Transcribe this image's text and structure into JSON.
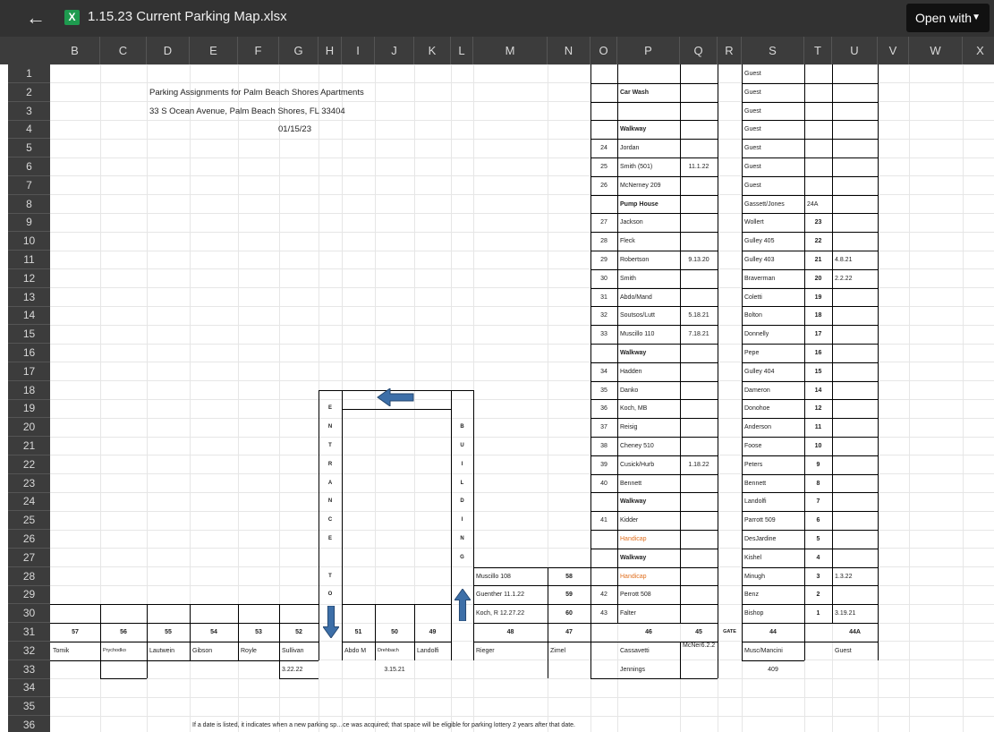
{
  "topbar": {
    "back_glyph": "←",
    "file_icon_letter": "X",
    "file_name": "1.15.23 Current Parking Map.xlsx",
    "open_with_label": "Open with",
    "open_with_caret": "▼"
  },
  "columns": [
    "B",
    "C",
    "D",
    "E",
    "F",
    "G",
    "H",
    "I",
    "J",
    "K",
    "L",
    "M",
    "N",
    "O",
    "P",
    "Q",
    "R",
    "S",
    "T",
    "U",
    "V",
    "W",
    "X"
  ],
  "rows": [
    "1",
    "2",
    "3",
    "4",
    "5",
    "6",
    "7",
    "8",
    "9",
    "10",
    "11",
    "12",
    "13",
    "14",
    "15",
    "16",
    "17",
    "18",
    "19",
    "20",
    "21",
    "22",
    "23",
    "24",
    "25",
    "26",
    "27",
    "28",
    "29",
    "30",
    "31",
    "32",
    "33",
    "34",
    "35",
    "36"
  ],
  "header": {
    "title": "Parking Assignments for Palm Beach Shores Apartments",
    "address": "33 S Ocean Avenue, Palm Beach Shores, FL  33404",
    "date": "01/15/23"
  },
  "colP": [
    {
      "row": 2,
      "num": "",
      "name": "Car Wash",
      "date": "",
      "bold": true
    },
    {
      "row": 4,
      "num": "",
      "name": "Walkway",
      "date": "",
      "bold": true
    },
    {
      "row": 5,
      "num": "24",
      "name": "Jordan",
      "date": ""
    },
    {
      "row": 6,
      "num": "25",
      "name": "Smith (501)",
      "date": "11.1.22"
    },
    {
      "row": 7,
      "num": "26",
      "name": "McNerney 209",
      "date": ""
    },
    {
      "row": 8,
      "num": "",
      "name": "Pump House",
      "date": "",
      "bold": true
    },
    {
      "row": 9,
      "num": "27",
      "name": "Jackson",
      "date": ""
    },
    {
      "row": 10,
      "num": "28",
      "name": "Fleck",
      "date": ""
    },
    {
      "row": 11,
      "num": "29",
      "name": "Robertson",
      "date": "9.13.20"
    },
    {
      "row": 12,
      "num": "30",
      "name": "Smith",
      "date": ""
    },
    {
      "row": 13,
      "num": "31",
      "name": "Abdo/Mand",
      "date": ""
    },
    {
      "row": 14,
      "num": "32",
      "name": "Soutsos/Lutt",
      "date": "5.18.21"
    },
    {
      "row": 15,
      "num": "33",
      "name": "Muscillo 110",
      "date": "7.18.21"
    },
    {
      "row": 16,
      "num": "",
      "name": "Walkway",
      "date": "",
      "bold": true
    },
    {
      "row": 17,
      "num": "34",
      "name": "Hadden",
      "date": ""
    },
    {
      "row": 18,
      "num": "35",
      "name": "Danko",
      "date": ""
    },
    {
      "row": 19,
      "num": "36",
      "name": "Koch, MB",
      "date": ""
    },
    {
      "row": 20,
      "num": "37",
      "name": "Reisig",
      "date": ""
    },
    {
      "row": 21,
      "num": "38",
      "name": "Cheney 510",
      "date": ""
    },
    {
      "row": 22,
      "num": "39",
      "name": "Cusick/Hurb",
      "date": "1.18.22"
    },
    {
      "row": 23,
      "num": "40",
      "name": "Bennett",
      "date": ""
    },
    {
      "row": 24,
      "num": "",
      "name": "Walkway",
      "date": "",
      "bold": true
    },
    {
      "row": 25,
      "num": "41",
      "name": "Kidder",
      "date": ""
    },
    {
      "row": 26,
      "num": "",
      "name": "Handicap",
      "date": "",
      "orange": true
    },
    {
      "row": 27,
      "num": "",
      "name": "Walkway",
      "date": "",
      "bold": true
    },
    {
      "row": 28,
      "num": "",
      "name": "Handicap",
      "date": "",
      "orange": true
    },
    {
      "row": 29,
      "num": "42",
      "name": "Perrott 508",
      "date": ""
    },
    {
      "row": 30,
      "num": "43",
      "name": "Falter",
      "date": ""
    }
  ],
  "colS": [
    {
      "row": 1,
      "name": "Guest",
      "num": "",
      "date": ""
    },
    {
      "row": 2,
      "name": "Guest",
      "num": "",
      "date": ""
    },
    {
      "row": 3,
      "name": "Guest",
      "num": "",
      "date": ""
    },
    {
      "row": 4,
      "name": "Guest",
      "num": "",
      "date": ""
    },
    {
      "row": 5,
      "name": "Guest",
      "num": "",
      "date": ""
    },
    {
      "row": 6,
      "name": "Guest",
      "num": "",
      "date": ""
    },
    {
      "row": 7,
      "name": "Guest",
      "num": "",
      "date": ""
    },
    {
      "row": 8,
      "name": "Gassett/Jones",
      "num": "24A",
      "date": ""
    },
    {
      "row": 9,
      "name": "Wollert",
      "num": "23",
      "date": ""
    },
    {
      "row": 10,
      "name": "Gulley 405",
      "num": "22",
      "date": ""
    },
    {
      "row": 11,
      "name": "Gulley 403",
      "num": "21",
      "date": "4.8.21"
    },
    {
      "row": 12,
      "name": "Braverman",
      "num": "20",
      "date": "2.2.22"
    },
    {
      "row": 13,
      "name": "Coletti",
      "num": "19",
      "date": ""
    },
    {
      "row": 14,
      "name": "Bolton",
      "num": "18",
      "date": ""
    },
    {
      "row": 15,
      "name": "Donnelly",
      "num": "17",
      "date": ""
    },
    {
      "row": 16,
      "name": "Pepe",
      "num": "16",
      "date": ""
    },
    {
      "row": 17,
      "name": "Gulley 404",
      "num": "15",
      "date": ""
    },
    {
      "row": 18,
      "name": "Dameron",
      "num": "14",
      "date": ""
    },
    {
      "row": 19,
      "name": "Donohoe",
      "num": "12",
      "date": ""
    },
    {
      "row": 20,
      "name": "Anderson",
      "num": "11",
      "date": ""
    },
    {
      "row": 21,
      "name": "Foose",
      "num": "10",
      "date": ""
    },
    {
      "row": 22,
      "name": "Peters",
      "num": "9",
      "date": ""
    },
    {
      "row": 23,
      "name": "Bennett",
      "num": "8",
      "date": ""
    },
    {
      "row": 24,
      "name": "Landolfi",
      "num": "7",
      "date": ""
    },
    {
      "row": 25,
      "name": "Parrott 509",
      "num": "6",
      "date": ""
    },
    {
      "row": 26,
      "name": "DesJardine",
      "num": "5",
      "date": ""
    },
    {
      "row": 27,
      "name": "Kishel",
      "num": "4",
      "date": ""
    },
    {
      "row": 28,
      "name": "Minugh",
      "num": "3",
      "date": "1.3.22"
    },
    {
      "row": 29,
      "name": "Benz",
      "num": "2",
      "date": ""
    },
    {
      "row": 30,
      "name": "Bishop",
      "num": "1",
      "date": "3.19.21"
    }
  ],
  "colM": [
    {
      "row": 28,
      "name": "Muscillo 108",
      "num": "58"
    },
    {
      "row": 29,
      "name": "Guenther 11.1.22",
      "num": "59"
    },
    {
      "row": 30,
      "name": "Koch, R 12.27.22",
      "num": "60"
    }
  ],
  "entrance_letters": [
    "E",
    "N",
    "T",
    "R",
    "A",
    "N",
    "C",
    "E",
    "",
    "T",
    "O"
  ],
  "building_letters": [
    "B",
    "U",
    "I",
    "L",
    "D",
    "I",
    "N",
    "G"
  ],
  "bottom_nums": [
    {
      "col": "B",
      "num": "57",
      "name": "Tomik",
      "extra": ""
    },
    {
      "col": "C",
      "num": "56",
      "name": "Prychodko",
      "extra": ""
    },
    {
      "col": "D",
      "num": "55",
      "name": "Lautwein",
      "extra": ""
    },
    {
      "col": "E",
      "num": "54",
      "name": "Gibson",
      "extra": ""
    },
    {
      "col": "F",
      "num": "53",
      "name": "Royle",
      "extra": ""
    },
    {
      "col": "G",
      "num": "52",
      "name": "Sullivan",
      "extra": "3.22.22"
    },
    {
      "col": "I",
      "num": "51",
      "name": "Abdo M",
      "extra": ""
    },
    {
      "col": "J",
      "num": "50",
      "name": "Drehbach",
      "extra": "3.15.21"
    },
    {
      "col": "K",
      "num": "49",
      "name": "Landolfi",
      "extra": ""
    },
    {
      "col": "M",
      "num": "48",
      "name": "Rieger",
      "extra": ""
    },
    {
      "col": "N",
      "num": "47",
      "name": "Zimel",
      "extra": ""
    },
    {
      "col": "P",
      "num": "46",
      "name": "Cassavetti",
      "extra": "Jennings"
    },
    {
      "col": "Q",
      "num": "45",
      "name": "McNer6.2.2",
      "extra": ""
    },
    {
      "col": "S",
      "num": "44",
      "name": "Musc/Mancini",
      "extra": "409"
    },
    {
      "col": "U",
      "num": "44A",
      "name": "Guest",
      "extra": ""
    }
  ],
  "gate_label": "GATE",
  "footnote": "If a date is listed, it indicates when a new parking sp…ce was acquired; that space will be eligible for parking lottery 2 years after that date."
}
